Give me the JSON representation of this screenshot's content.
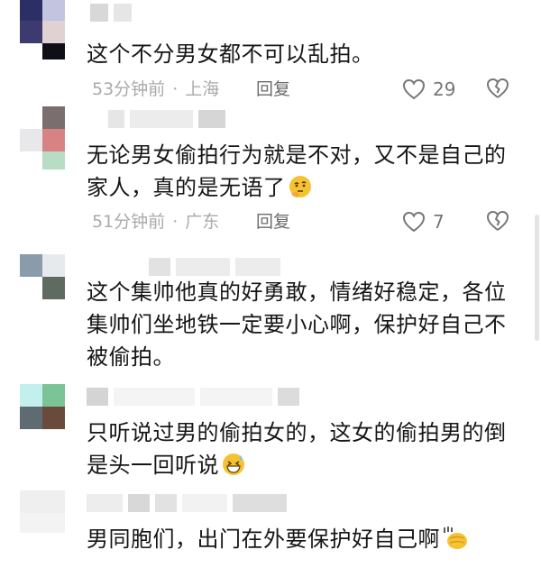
{
  "comments": [
    {
      "text": "这个不分男女都不可以乱拍。",
      "time": "53分钟前",
      "location": "上海",
      "reply": "回复",
      "likes": "29"
    },
    {
      "text": "无论男女偷拍行为就是不对，又不是自己的家人，真的是无语了",
      "emoji": "thinking-face-icon",
      "time": "51分钟前",
      "location": "广东",
      "reply": "回复",
      "likes": "7"
    },
    {
      "text": "这个集帅他真的好勇敢，情绪好稳定，各位集帅们坐地铁一定要小心啊，保护好自己不被偷拍。"
    },
    {
      "text": "只听说过男的偷拍女的，这女的偷拍男的倒是头一回听说",
      "emoji": "grinning-sweat-face-icon"
    },
    {
      "text": "男同胞们，出门在外要保护好自己啊",
      "emoji": "clapping-hands-icon"
    }
  ],
  "colors": {
    "text": "#161616",
    "meta": "#aaaaaa",
    "reply": "#6b6b6b",
    "emoji": "#f5c331"
  }
}
